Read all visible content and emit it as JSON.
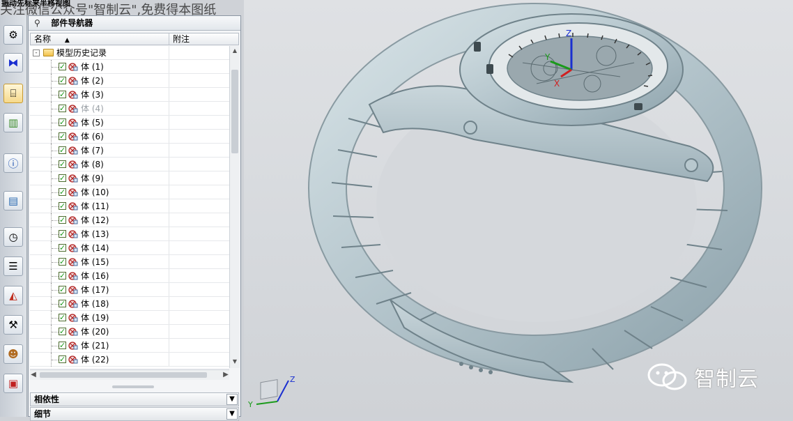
{
  "overlay": {
    "hint": "振动先标来半移视图",
    "watermark": "关注微信公众号\"智制云\",免费得本图纸"
  },
  "resource_bar": {
    "items": [
      {
        "icon": "assembly-icon"
      },
      {
        "icon": "constraint-icon"
      },
      {
        "icon": "part-navigator-icon",
        "active": true
      },
      {
        "icon": "library-books-icon"
      },
      {
        "icon": "info-icon"
      },
      {
        "icon": "document-icon"
      },
      {
        "icon": "history-clock-icon"
      },
      {
        "icon": "list-icon"
      },
      {
        "icon": "color-roles-icon"
      },
      {
        "icon": "system-tools-icon"
      },
      {
        "icon": "users-icon"
      },
      {
        "icon": "palette-icon"
      }
    ]
  },
  "navigator": {
    "title": "部件导航器",
    "columns": {
      "name": "名称",
      "note": "附注"
    },
    "root": {
      "label": "模型历史记录",
      "expander": "-"
    },
    "bodies": [
      {
        "label": "体 (1)",
        "checked": true
      },
      {
        "label": "体 (2)",
        "checked": true
      },
      {
        "label": "体 (3)",
        "checked": true
      },
      {
        "label": "体 (4)",
        "checked": true,
        "dim": true
      },
      {
        "label": "体 (5)",
        "checked": true
      },
      {
        "label": "体 (6)",
        "checked": true
      },
      {
        "label": "体 (7)",
        "checked": true
      },
      {
        "label": "体 (8)",
        "checked": true
      },
      {
        "label": "体 (9)",
        "checked": true
      },
      {
        "label": "体 (10)",
        "checked": true
      },
      {
        "label": "体 (11)",
        "checked": true
      },
      {
        "label": "体 (12)",
        "checked": true
      },
      {
        "label": "体 (13)",
        "checked": true
      },
      {
        "label": "体 (14)",
        "checked": true
      },
      {
        "label": "体 (15)",
        "checked": true
      },
      {
        "label": "体 (16)",
        "checked": true
      },
      {
        "label": "体 (17)",
        "checked": true
      },
      {
        "label": "体 (18)",
        "checked": true
      },
      {
        "label": "体 (19)",
        "checked": true
      },
      {
        "label": "体 (20)",
        "checked": true
      },
      {
        "label": "体 (21)",
        "checked": true
      },
      {
        "label": "体 (22)",
        "checked": true
      }
    ],
    "sections": {
      "dependency": "相依性",
      "details": "细节"
    }
  },
  "viewport": {
    "triad": {
      "x": "X",
      "y": "Y",
      "z": "Z"
    },
    "wcs": {
      "y": "Y",
      "z": "Z"
    },
    "brand": "智制云"
  },
  "colors": {
    "model": "#b9c9cf",
    "accent_check": "#1a9a1a"
  }
}
